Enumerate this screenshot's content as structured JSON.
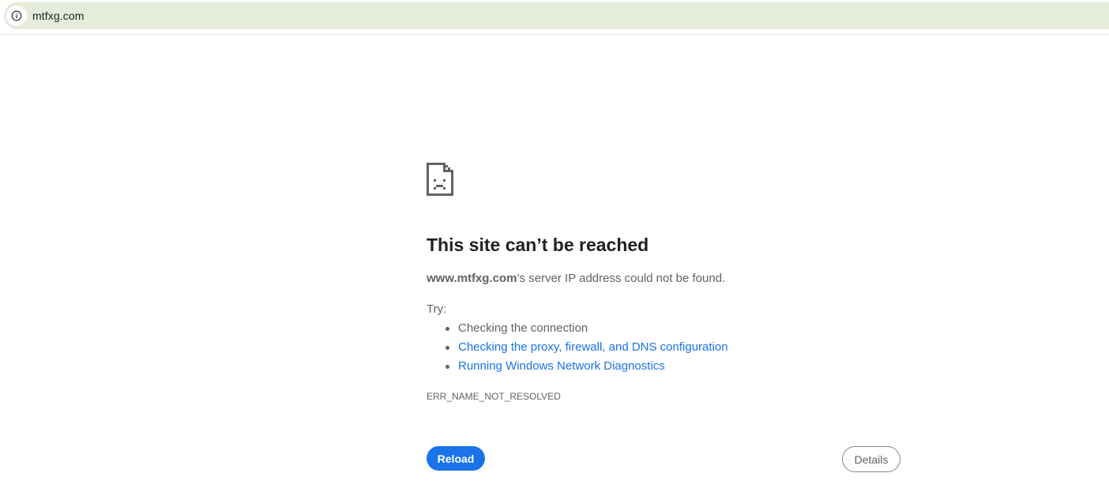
{
  "browser": {
    "url": "mtfxg.com",
    "site_info_icon": "info-circle-icon"
  },
  "error_page": {
    "icon": "sad-document-icon",
    "heading": "This site can’t be reached",
    "host": "www.mtfxg.com",
    "summary_rest": "’s server IP address could not be found.",
    "try_label": "Try:",
    "suggestions": [
      {
        "label": "Checking the connection",
        "is_link": false
      },
      {
        "label": "Checking the proxy, firewall, and DNS configuration",
        "is_link": true
      },
      {
        "label": "Running Windows Network Diagnostics",
        "is_link": true
      }
    ],
    "error_code": "ERR_NAME_NOT_RESOLVED",
    "reload_label": "Reload",
    "details_label": "Details"
  },
  "colors": {
    "address_bar_bg": "#e5ecdc",
    "primary_blue": "#1a73e8",
    "text_secondary": "#5f6368",
    "heading_text": "#202124"
  }
}
